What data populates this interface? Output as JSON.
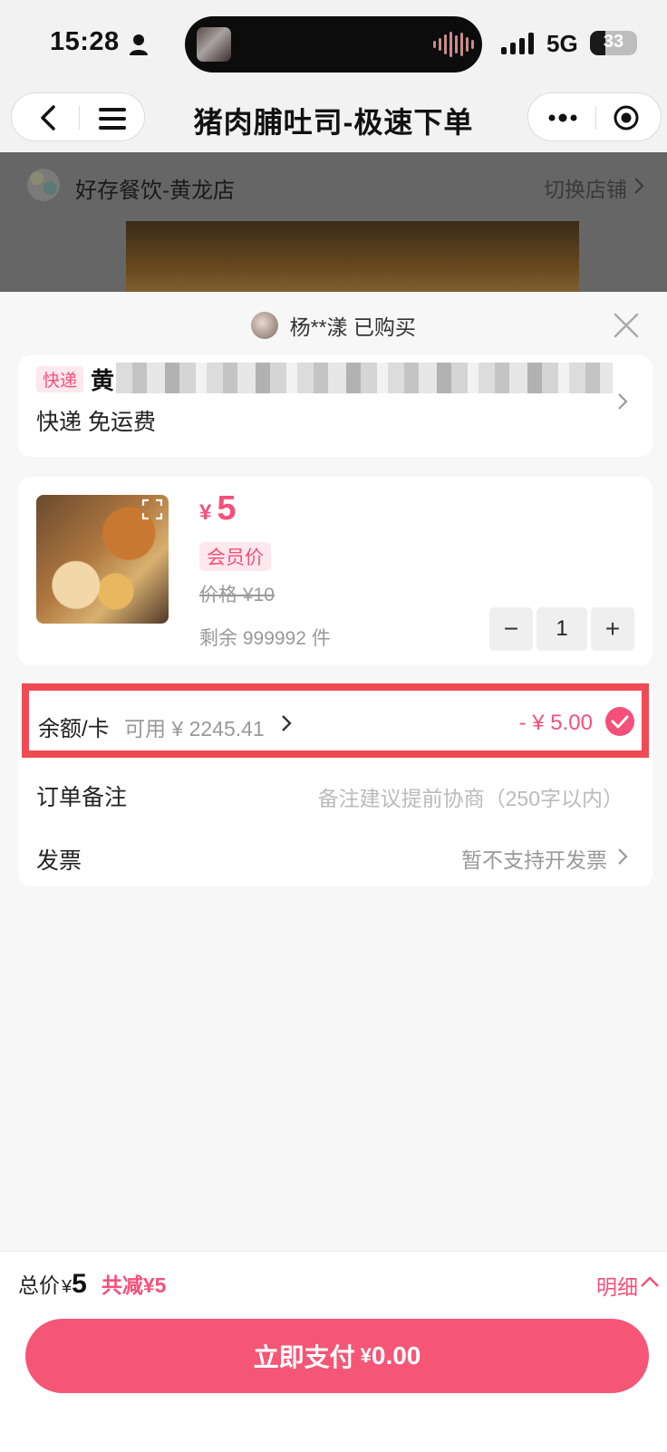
{
  "status_bar": {
    "time": "15:28",
    "network": "5G",
    "battery": "33"
  },
  "nav": {
    "title": "猪肉脯吐司-极速下单"
  },
  "store": {
    "name": "好存餐饮-黄龙店",
    "switch_label": "切换店铺"
  },
  "buyer_notice": "杨**漾 已购买",
  "address": {
    "tag": "快递",
    "first_char": "黄",
    "shipping": "快递 免运费"
  },
  "product": {
    "price_symbol": "¥",
    "price": "5",
    "member_tag": "会员价",
    "original_price": "价格 ¥10",
    "stock": "剩余 999992 件",
    "quantity": "1",
    "minus": "−",
    "plus": "+"
  },
  "balance": {
    "label": "余额/卡",
    "available": "可用 ¥ 2245.41",
    "deduction": "- ¥ 5.00"
  },
  "remark": {
    "label": "订单备注",
    "placeholder": "备注建议提前协商（250字以内）"
  },
  "invoice": {
    "label": "发票",
    "value": "暂不支持开发票"
  },
  "summary": {
    "total_label": "总价",
    "total_symbol": "¥",
    "total_amount": "5",
    "reduction": "共减¥5",
    "detail_label": "明细"
  },
  "pay": {
    "label": "立即支付",
    "symbol": "¥",
    "amount": "0.00"
  },
  "colors": {
    "accent": "#f5507a",
    "highlight_border": "#f04a55",
    "pay_button": "#f55675"
  },
  "icons": [
    "person-icon",
    "back-icon",
    "menu-icon",
    "more-icon",
    "target-icon",
    "chevron-right-icon",
    "close-icon",
    "expand-icon",
    "check-icon",
    "chevron-up-icon"
  ]
}
